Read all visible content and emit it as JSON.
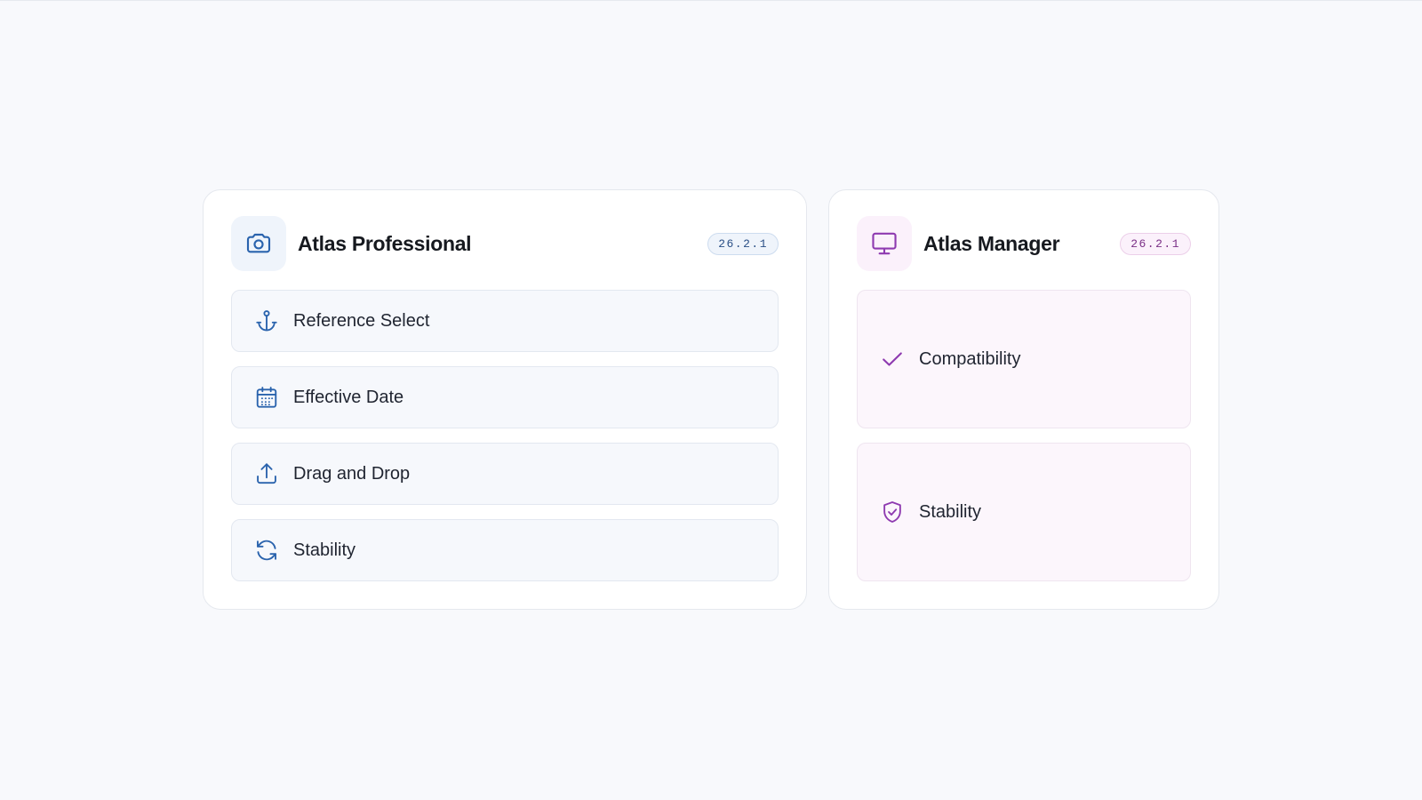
{
  "products": [
    {
      "name": "Atlas Professional",
      "version": "26.2.1",
      "icon": "camera-icon",
      "accent": "#2a63ad",
      "features": [
        {
          "label": "Reference Select",
          "icon": "anchor-icon"
        },
        {
          "label": "Effective Date",
          "icon": "calendar-icon"
        },
        {
          "label": "Drag and Drop",
          "icon": "upload-icon"
        },
        {
          "label": "Stability",
          "icon": "refresh-icon"
        }
      ]
    },
    {
      "name": "Atlas Manager",
      "version": "26.2.1",
      "icon": "monitor-icon",
      "accent": "#8e3ab0",
      "features": [
        {
          "label": "Compatibility",
          "icon": "check-icon"
        },
        {
          "label": "Stability",
          "icon": "shield-check-icon"
        }
      ]
    }
  ]
}
